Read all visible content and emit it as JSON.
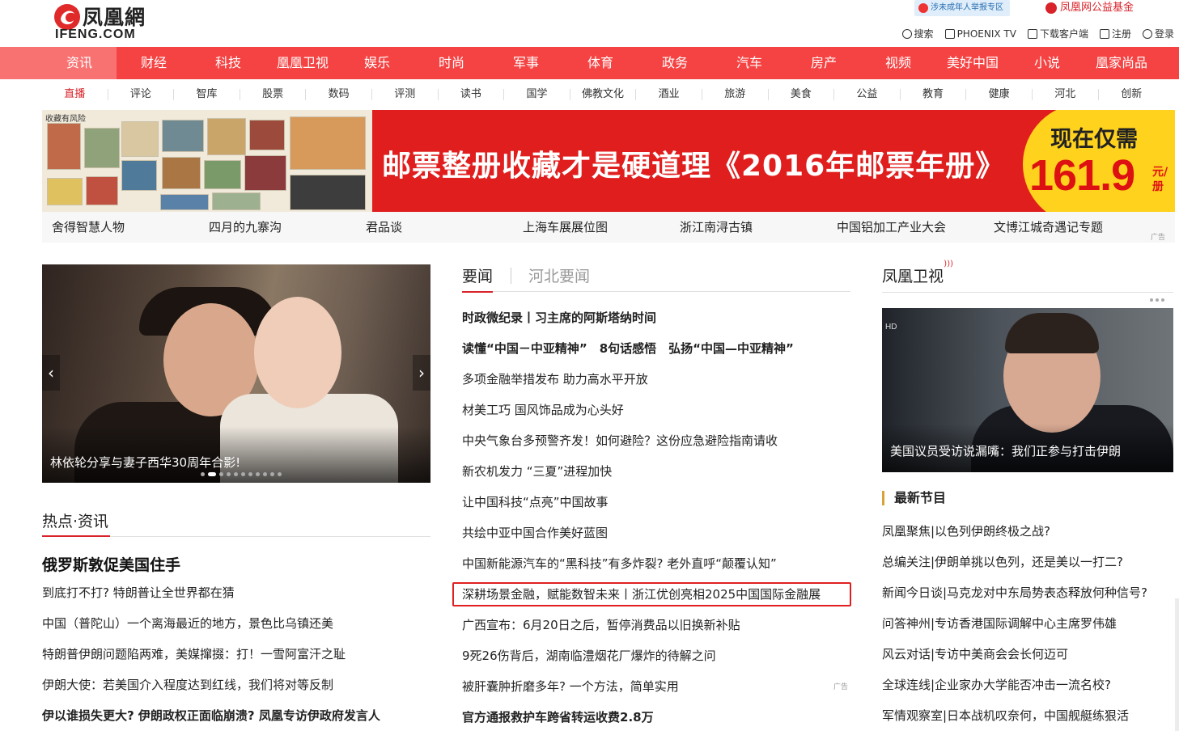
{
  "header": {
    "logo_cn": "凤凰網",
    "logo_en": "IFENG.COM",
    "promo_minor": "涉未成年人举报专区",
    "promo_charity": "凤凰网公益基金",
    "tools": [
      {
        "label": "搜索",
        "icon": "search-icon"
      },
      {
        "label": "PHOENIX TV",
        "icon": "tv-icon"
      },
      {
        "label": "下载客户端",
        "icon": "download-icon"
      },
      {
        "label": "注册",
        "icon": "register-icon"
      },
      {
        "label": "登录",
        "icon": "user-icon"
      }
    ]
  },
  "nav": [
    "资讯",
    "财经",
    "科技",
    "凰凰卫视",
    "娱乐",
    "时尚",
    "军事",
    "体育",
    "政务",
    "汽车",
    "房产",
    "视频",
    "美好中国",
    "小说",
    "凰家尚品"
  ],
  "subnav": {
    "active": "直播",
    "items": [
      "直播",
      "评论",
      "智库",
      "股票",
      "数码",
      "评测",
      "读书",
      "国学",
      "佛教文化",
      "酒业",
      "旅游",
      "美食",
      "公益",
      "教育",
      "健康",
      "河北",
      "创新"
    ]
  },
  "banner": {
    "warning": "收藏有风险",
    "slogan": "邮票整册收藏才是硬道理《2016年邮票年册》",
    "now": "现在仅需",
    "price": "161.9",
    "unit": "元/册"
  },
  "links": {
    "items": [
      "舍得智慧人物",
      "四月的九寨沟",
      "君品谈",
      "上海车展展位图",
      "浙江南浔古镇",
      "中国铝加工产业大会",
      "文博江城奇遇记专题"
    ],
    "ad": "广告"
  },
  "slider": {
    "caption": "林依轮分享与妻子西华30周年合影!",
    "prev": "‹",
    "next": "›",
    "dot_count": 11,
    "active_dot": 1
  },
  "hot": {
    "title": "热点·资讯",
    "headline": "俄罗斯敦促美国住手",
    "items": [
      {
        "text": "到底打不打? 特朗普让全世界都在猜",
        "bold": false
      },
      {
        "text": "中国（普陀山）一个离海最近的地方，景色比乌镇还美",
        "bold": false
      },
      {
        "text": "特朗普伊朗问题陷两难，美媒撺掇：打！一雪阿富汗之耻",
        "bold": false
      },
      {
        "text": "伊朗大使：若美国介入程度达到红线，我们将对等反制",
        "bold": false
      },
      {
        "text": "伊以谁损失更大? 伊朗政权正面临崩溃? 凤凰专访伊政府发言人",
        "bold": true
      }
    ]
  },
  "news": {
    "tab_active": "要闻",
    "tab_other": "河北要闻",
    "ad": "广告",
    "items": [
      {
        "text": "时政微纪录丨习主席的阿斯塔纳时间",
        "bold": true
      },
      {
        "text": "读懂“中国－中亚精神”　8句话感悟　弘扬“中国—中亚精神”",
        "bold": true
      },
      {
        "text": "多项金融举措发布 助力高水平开放",
        "bold": false
      },
      {
        "text": "材美工巧 国风饰品成为心头好",
        "bold": false
      },
      {
        "text": "中央气象台多预警齐发！如何避险？这份应急避险指南请收",
        "bold": false
      },
      {
        "text": "新农机发力 “三夏”进程加快",
        "bold": false
      },
      {
        "text": "让中国科技“点亮”中国故事",
        "bold": false
      },
      {
        "text": "共绘中亚中国合作美好蓝图",
        "bold": false
      },
      {
        "text": "中国新能源汽车的“黑科技”有多炸裂? 老外直呼“颠覆认知”",
        "bold": false
      },
      {
        "text": "深耕场景金融，赋能数智未来丨浙江优创亮相2025中国国际金融展",
        "bold": false
      },
      {
        "text": "广西宣布：6月20日之后，暂停消费品以旧换新补贴",
        "bold": false
      },
      {
        "text": "9死26伤背后，湖南临澧烟花厂爆炸的待解之问",
        "bold": false
      },
      {
        "text": "被肝囊肿折磨多年? 一个方法，简单实用",
        "bold": false
      },
      {
        "text": "官方通报救护车跨省转运收费2.8万",
        "bold": true
      }
    ]
  },
  "tv": {
    "title": "凤凰卫视",
    "video_caption": "美国议员受访说漏嘴：我们正参与打击伊朗",
    "video_badge": "HD",
    "latest_title": "最新节目",
    "items": [
      "凤凰聚焦|以色列伊朗终极之战?",
      "总编关注|伊朗单挑以色列，还是美以一打二?",
      "新闻今日谈|马克龙对中东局势表态释放何种信号?",
      "问答神州|专访香港国际调解中心主席罗伟雄",
      "风云对话|专访中美商会会长何迈可",
      "全球连线|企业家办大学能否冲击一流名校?",
      "军情观察室|日本战机叹奈何，中国舰艇练狠活"
    ]
  },
  "colors": {
    "brand_red": "#f54343",
    "nav_active": "#f87272",
    "highlight_box": "#e02020",
    "price_bg": "#ffd21e"
  }
}
